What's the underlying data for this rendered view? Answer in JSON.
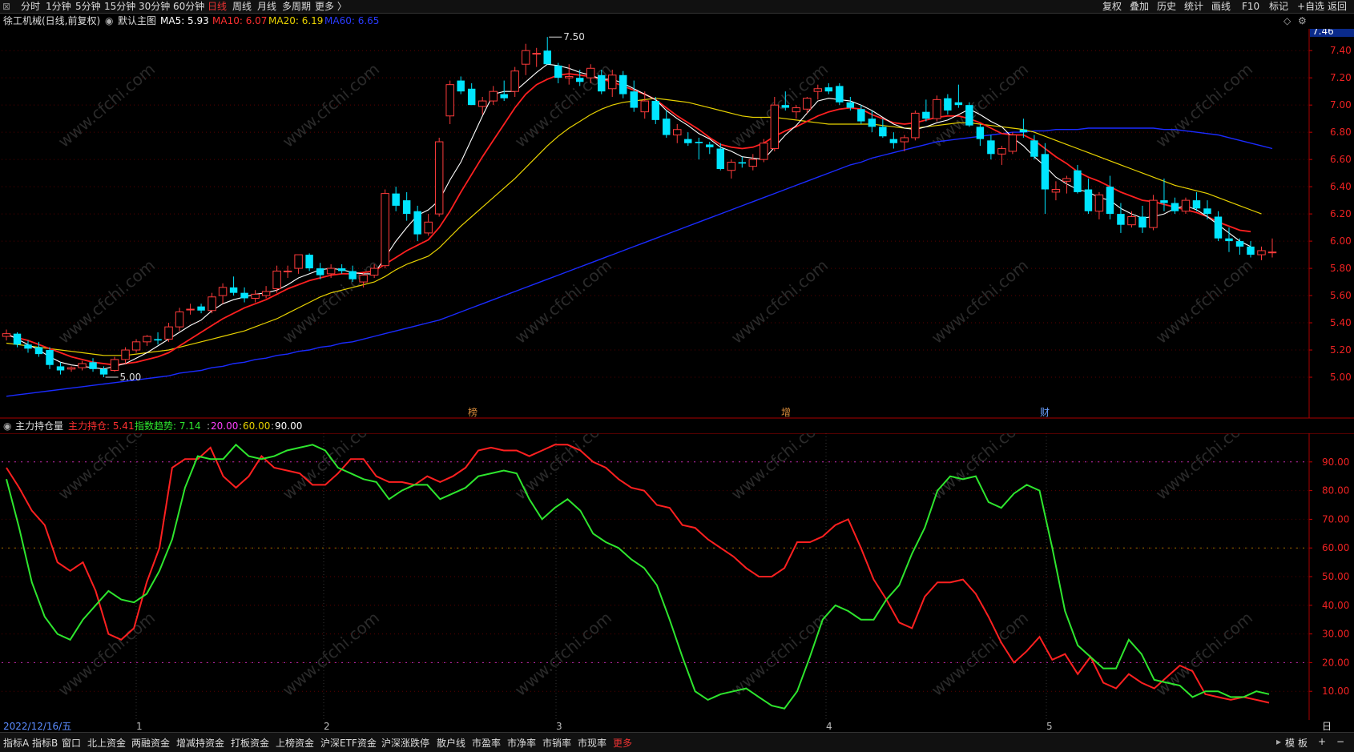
{
  "toolbar": {
    "periods": [
      "分时",
      "1分钟",
      "5分钟",
      "15分钟",
      "30分钟",
      "60分钟",
      "日线",
      "周线",
      "月线",
      "多周期",
      "更多 〉"
    ],
    "active_period": "日线",
    "right_items": [
      "复权",
      "叠加",
      "历史",
      "统计",
      "画线",
      "F10",
      "标记",
      "+自选",
      "返回"
    ]
  },
  "title": {
    "stock": "徐工机械(日线,前复权)",
    "template": "默认主图",
    "ma5": "MA5: 5.93",
    "ma10": "MA10: 6.07",
    "ma20": "MA20: 6.19",
    "ma60": "MA60: 6.65"
  },
  "colors": {
    "up": "#ff3b3b",
    "down": "#00e5ff",
    "ma5": "#ffffff",
    "ma10": "#ff2020",
    "ma20": "#e8d200",
    "ma60": "#1a2bff",
    "kdj_red": "#ff2020",
    "kdj_green": "#2ee62e",
    "grid": "#5a0000"
  },
  "indicator": {
    "name": "主力持仓量",
    "main": "主力持仓: 5.41",
    "trend": "指数趋势: 7.14",
    "l20": "20.00",
    "l60": "60.00",
    "l90": "90.00"
  },
  "price_axis": {
    "current": "7.46",
    "ticks": [
      "7.40",
      "7.20",
      "7.00",
      "6.80",
      "6.60",
      "6.40",
      "6.20",
      "6.00",
      "5.80",
      "5.60",
      "5.40",
      "5.20",
      "5.00"
    ]
  },
  "ind_axis": {
    "ticks": [
      "90.00",
      "80.00",
      "70.00",
      "60.00",
      "50.00",
      "40.00",
      "30.00",
      "20.00",
      "10.00"
    ]
  },
  "annotations": {
    "high": "7.50",
    "low": "5.00",
    "events": [
      "榜",
      "增",
      "财"
    ]
  },
  "date_axis": {
    "first_date": "2022/12/16/五",
    "months": [
      "1",
      "2",
      "3",
      "4",
      "5"
    ],
    "period": "日线"
  },
  "watermark": "www.cfchi.com",
  "bottom_tabs": [
    "指标A",
    "指标B",
    "窗口",
    "北上资金",
    "两融资金",
    "增减持资金",
    "打板资金",
    "上榜资金",
    "沪深ETF资金",
    "沪深涨跌停",
    "散户线",
    "市盈率",
    "市净率",
    "市销率",
    "市现率",
    "更多"
  ],
  "bottom_right": [
    "模",
    "板",
    "+",
    "−"
  ],
  "chart_data": {
    "type": "candlestick",
    "candles": [
      [
        5.3,
        5.35,
        5.27,
        5.32
      ],
      [
        5.32,
        5.33,
        5.22,
        5.24
      ],
      [
        5.24,
        5.27,
        5.18,
        5.21
      ],
      [
        5.22,
        5.26,
        5.15,
        5.17
      ],
      [
        5.2,
        5.22,
        5.06,
        5.09
      ],
      [
        5.08,
        5.11,
        5.02,
        5.05
      ],
      [
        5.06,
        5.08,
        5.04,
        5.07
      ],
      [
        5.07,
        5.12,
        5.05,
        5.1
      ],
      [
        5.11,
        5.14,
        5.04,
        5.06
      ],
      [
        5.06,
        5.08,
        5.0,
        5.02
      ],
      [
        5.05,
        5.15,
        5.04,
        5.13
      ],
      [
        5.13,
        5.22,
        5.1,
        5.2
      ],
      [
        5.2,
        5.28,
        5.18,
        5.26
      ],
      [
        5.26,
        5.31,
        5.23,
        5.3
      ],
      [
        5.28,
        5.33,
        5.24,
        5.27
      ],
      [
        5.28,
        5.4,
        5.26,
        5.37
      ],
      [
        5.37,
        5.51,
        5.34,
        5.48
      ],
      [
        5.5,
        5.54,
        5.46,
        5.5
      ],
      [
        5.52,
        5.54,
        5.47,
        5.49
      ],
      [
        5.49,
        5.62,
        5.47,
        5.59
      ],
      [
        5.6,
        5.69,
        5.54,
        5.66
      ],
      [
        5.66,
        5.74,
        5.6,
        5.62
      ],
      [
        5.62,
        5.66,
        5.55,
        5.58
      ],
      [
        5.58,
        5.64,
        5.55,
        5.61
      ],
      [
        5.6,
        5.67,
        5.58,
        5.63
      ],
      [
        5.65,
        5.82,
        5.62,
        5.78
      ],
      [
        5.78,
        5.82,
        5.73,
        5.78
      ],
      [
        5.8,
        5.9,
        5.76,
        5.9
      ],
      [
        5.9,
        5.91,
        5.78,
        5.8
      ],
      [
        5.8,
        5.84,
        5.72,
        5.75
      ],
      [
        5.76,
        5.83,
        5.73,
        5.8
      ],
      [
        5.8,
        5.83,
        5.76,
        5.78
      ],
      [
        5.78,
        5.82,
        5.7,
        5.72
      ],
      [
        5.7,
        5.77,
        5.66,
        5.75
      ],
      [
        5.75,
        5.83,
        5.73,
        5.8
      ],
      [
        5.82,
        6.38,
        5.8,
        6.35
      ],
      [
        6.35,
        6.4,
        6.22,
        6.26
      ],
      [
        6.3,
        6.36,
        6.15,
        6.2
      ],
      [
        6.22,
        6.26,
        6.0,
        6.05
      ],
      [
        6.06,
        6.2,
        6.04,
        6.14
      ],
      [
        6.2,
        6.76,
        6.18,
        6.73
      ],
      [
        6.92,
        7.18,
        6.86,
        7.15
      ],
      [
        7.18,
        7.21,
        7.08,
        7.1
      ],
      [
        7.12,
        7.16,
        7.0,
        7.0
      ],
      [
        6.99,
        7.06,
        6.93,
        7.03
      ],
      [
        7.03,
        7.14,
        7.0,
        7.1
      ],
      [
        7.08,
        7.18,
        7.03,
        7.05
      ],
      [
        7.1,
        7.28,
        7.06,
        7.25
      ],
      [
        7.3,
        7.45,
        7.22,
        7.4
      ],
      [
        7.38,
        7.42,
        7.28,
        7.38
      ],
      [
        7.4,
        7.5,
        7.3,
        7.3
      ],
      [
        7.29,
        7.31,
        7.16,
        7.2
      ],
      [
        7.2,
        7.3,
        7.15,
        7.21
      ],
      [
        7.2,
        7.26,
        7.14,
        7.17
      ],
      [
        7.2,
        7.3,
        7.16,
        7.27
      ],
      [
        7.22,
        7.26,
        7.08,
        7.1
      ],
      [
        7.12,
        7.26,
        7.06,
        7.22
      ],
      [
        7.22,
        7.25,
        7.05,
        7.08
      ],
      [
        7.1,
        7.18,
        6.95,
        6.98
      ],
      [
        6.95,
        7.1,
        6.9,
        7.03
      ],
      [
        7.03,
        7.06,
        6.86,
        6.89
      ],
      [
        6.9,
        6.96,
        6.76,
        6.78
      ],
      [
        6.78,
        6.86,
        6.72,
        6.82
      ],
      [
        6.75,
        6.8,
        6.7,
        6.72
      ],
      [
        6.73,
        6.76,
        6.6,
        6.72
      ],
      [
        6.71,
        6.73,
        6.64,
        6.69
      ],
      [
        6.68,
        6.72,
        6.52,
        6.53
      ],
      [
        6.52,
        6.6,
        6.46,
        6.58
      ],
      [
        6.58,
        6.62,
        6.54,
        6.57
      ],
      [
        6.55,
        6.64,
        6.52,
        6.6
      ],
      [
        6.6,
        6.75,
        6.58,
        6.72
      ],
      [
        6.68,
        7.06,
        6.66,
        7.0
      ],
      [
        7.0,
        7.1,
        6.96,
        6.98
      ],
      [
        6.95,
        7.0,
        6.9,
        6.98
      ],
      [
        6.97,
        7.06,
        6.94,
        7.05
      ],
      [
        7.1,
        7.15,
        7.04,
        7.12
      ],
      [
        7.13,
        7.16,
        7.08,
        7.1
      ],
      [
        7.14,
        7.16,
        7.0,
        7.02
      ],
      [
        7.02,
        7.06,
        6.96,
        6.98
      ],
      [
        6.97,
        7.0,
        6.86,
        6.88
      ],
      [
        6.9,
        6.96,
        6.8,
        6.84
      ],
      [
        6.84,
        6.9,
        6.76,
        6.77
      ],
      [
        6.75,
        6.8,
        6.68,
        6.72
      ],
      [
        6.73,
        6.78,
        6.66,
        6.76
      ],
      [
        6.76,
        6.96,
        6.74,
        6.94
      ],
      [
        6.95,
        7.04,
        6.88,
        6.9
      ],
      [
        6.9,
        7.07,
        6.88,
        7.04
      ],
      [
        7.05,
        7.08,
        6.93,
        6.96
      ],
      [
        7.02,
        7.15,
        6.98,
        7.0
      ],
      [
        7.0,
        7.02,
        6.84,
        6.85
      ],
      [
        6.84,
        6.86,
        6.7,
        6.75
      ],
      [
        6.74,
        6.78,
        6.6,
        6.64
      ],
      [
        6.64,
        6.7,
        6.56,
        6.68
      ],
      [
        6.66,
        6.8,
        6.64,
        6.78
      ],
      [
        6.82,
        6.9,
        6.76,
        6.8
      ],
      [
        6.74,
        6.78,
        6.6,
        6.62
      ],
      [
        6.64,
        6.72,
        6.2,
        6.38
      ],
      [
        6.36,
        6.44,
        6.3,
        6.38
      ],
      [
        6.44,
        6.48,
        6.35,
        6.46
      ],
      [
        6.52,
        6.56,
        6.35,
        6.36
      ],
      [
        6.38,
        6.46,
        6.2,
        6.22
      ],
      [
        6.22,
        6.36,
        6.16,
        6.34
      ],
      [
        6.4,
        6.48,
        6.16,
        6.2
      ],
      [
        6.2,
        6.28,
        6.06,
        6.12
      ],
      [
        6.12,
        6.22,
        6.1,
        6.18
      ],
      [
        6.18,
        6.26,
        6.06,
        6.1
      ],
      [
        6.1,
        6.34,
        6.08,
        6.3
      ],
      [
        6.3,
        6.46,
        6.22,
        6.28
      ],
      [
        6.28,
        6.32,
        6.2,
        6.22
      ],
      [
        6.22,
        6.32,
        6.2,
        6.3
      ],
      [
        6.3,
        6.36,
        6.22,
        6.24
      ],
      [
        6.24,
        6.3,
        6.16,
        6.2
      ],
      [
        6.18,
        6.22,
        6.0,
        6.02
      ],
      [
        6.02,
        6.1,
        5.92,
        6.0
      ],
      [
        6.0,
        6.02,
        5.9,
        5.96
      ],
      [
        5.96,
        6.0,
        5.88,
        5.9
      ],
      [
        5.9,
        5.96,
        5.86,
        5.93
      ],
      [
        5.92,
        6.02,
        5.88,
        5.92
      ]
    ],
    "ma60": [
      4.86,
      4.87,
      4.88,
      4.89,
      4.9,
      4.91,
      4.92,
      4.93,
      4.94,
      4.95,
      4.96,
      4.97,
      4.98,
      4.99,
      5.0,
      5.01,
      5.03,
      5.04,
      5.05,
      5.07,
      5.08,
      5.1,
      5.11,
      5.13,
      5.14,
      5.16,
      5.17,
      5.19,
      5.2,
      5.22,
      5.23,
      5.25,
      5.26,
      5.28,
      5.3,
      5.32,
      5.34,
      5.36,
      5.38,
      5.4,
      5.42,
      5.45,
      5.48,
      5.51,
      5.54,
      5.57,
      5.6,
      5.63,
      5.66,
      5.69,
      5.72,
      5.75,
      5.78,
      5.81,
      5.84,
      5.87,
      5.9,
      5.93,
      5.96,
      5.99,
      6.02,
      6.05,
      6.08,
      6.11,
      6.14,
      6.17,
      6.2,
      6.23,
      6.26,
      6.29,
      6.32,
      6.35,
      6.38,
      6.41,
      6.44,
      6.47,
      6.5,
      6.53,
      6.56,
      6.58,
      6.61,
      6.63,
      6.65,
      6.67,
      6.69,
      6.71,
      6.73,
      6.74,
      6.75,
      6.76,
      6.77,
      6.78,
      6.79,
      6.8,
      6.8,
      6.81,
      6.81,
      6.82,
      6.82,
      6.82,
      6.83,
      6.83,
      6.83,
      6.83,
      6.83,
      6.83,
      6.83,
      6.82,
      6.82,
      6.81,
      6.8,
      6.79,
      6.78,
      6.76,
      6.74,
      6.72,
      6.7,
      6.68
    ],
    "ma20": [
      5.25,
      5.24,
      5.23,
      5.22,
      5.21,
      5.2,
      5.19,
      5.18,
      5.17,
      5.16,
      5.16,
      5.16,
      5.17,
      5.18,
      5.19,
      5.2,
      5.22,
      5.24,
      5.26,
      5.28,
      5.3,
      5.32,
      5.34,
      5.37,
      5.4,
      5.43,
      5.47,
      5.51,
      5.55,
      5.59,
      5.62,
      5.64,
      5.66,
      5.68,
      5.7,
      5.74,
      5.79,
      5.83,
      5.86,
      5.89,
      5.95,
      6.03,
      6.11,
      6.18,
      6.25,
      6.32,
      6.39,
      6.46,
      6.54,
      6.62,
      6.7,
      6.77,
      6.83,
      6.88,
      6.93,
      6.97,
      7.0,
      7.02,
      7.03,
      7.04,
      7.05,
      7.04,
      7.03,
      7.02,
      7.0,
      6.98,
      6.96,
      6.94,
      6.92,
      6.91,
      6.91,
      6.91,
      6.9,
      6.89,
      6.88,
      6.87,
      6.86,
      6.86,
      6.86,
      6.86,
      6.86,
      6.85,
      6.84,
      6.83,
      6.83,
      6.84,
      6.85,
      6.86,
      6.87,
      6.87,
      6.86,
      6.85,
      6.84,
      6.83,
      6.82,
      6.8,
      6.77,
      6.74,
      6.71,
      6.68,
      6.65,
      6.62,
      6.59,
      6.56,
      6.53,
      6.5,
      6.47,
      6.44,
      6.41,
      6.39,
      6.37,
      6.35,
      6.32,
      6.29,
      6.26,
      6.23,
      6.2
    ],
    "ma10": [
      5.31,
      5.29,
      5.27,
      5.24,
      5.21,
      5.18,
      5.15,
      5.13,
      5.11,
      5.1,
      5.09,
      5.1,
      5.11,
      5.13,
      5.15,
      5.18,
      5.23,
      5.28,
      5.33,
      5.38,
      5.43,
      5.47,
      5.51,
      5.54,
      5.57,
      5.61,
      5.65,
      5.68,
      5.71,
      5.73,
      5.75,
      5.76,
      5.76,
      5.77,
      5.78,
      5.83,
      5.88,
      5.93,
      5.97,
      6.01,
      6.1,
      6.22,
      6.36,
      6.49,
      6.62,
      6.74,
      6.86,
      6.98,
      7.08,
      7.15,
      7.19,
      7.22,
      7.23,
      7.22,
      7.21,
      7.19,
      7.17,
      7.14,
      7.11,
      7.08,
      7.04,
      6.98,
      6.92,
      6.87,
      6.82,
      6.76,
      6.71,
      6.69,
      6.68,
      6.69,
      6.72,
      6.77,
      6.81,
      6.84,
      6.88,
      6.92,
      6.95,
      6.97,
      6.98,
      6.97,
      6.93,
      6.9,
      6.87,
      6.86,
      6.87,
      6.89,
      6.91,
      6.92,
      6.92,
      6.9,
      6.87,
      6.83,
      6.79,
      6.78,
      6.78,
      6.74,
      6.68,
      6.62,
      6.57,
      6.51,
      6.47,
      6.44,
      6.4,
      6.36,
      6.33,
      6.3,
      6.29,
      6.27,
      6.25,
      6.23,
      6.21,
      6.18,
      6.14,
      6.11,
      6.08,
      6.07
    ],
    "ma5": [
      5.32,
      5.28,
      5.24,
      5.2,
      5.15,
      5.11,
      5.09,
      5.08,
      5.07,
      5.06,
      5.08,
      5.1,
      5.14,
      5.18,
      5.23,
      5.28,
      5.33,
      5.38,
      5.42,
      5.49,
      5.54,
      5.57,
      5.59,
      5.61,
      5.62,
      5.64,
      5.68,
      5.73,
      5.76,
      5.79,
      5.8,
      5.79,
      5.77,
      5.76,
      5.76,
      5.88,
      6.0,
      6.1,
      6.19,
      6.23,
      6.3,
      6.45,
      6.58,
      6.75,
      6.92,
      7.08,
      7.1,
      7.1,
      7.17,
      7.24,
      7.3,
      7.29,
      7.27,
      7.24,
      7.22,
      7.19,
      7.19,
      7.16,
      7.12,
      7.08,
      7.04,
      6.96,
      6.9,
      6.85,
      6.79,
      6.75,
      6.69,
      6.66,
      6.62,
      6.61,
      6.6,
      6.69,
      6.78,
      6.85,
      6.94,
      7.03,
      7.05,
      7.04,
      7.03,
      7.0,
      6.96,
      6.91,
      6.86,
      6.83,
      6.82,
      6.84,
      6.87,
      6.89,
      6.93,
      6.97,
      6.93,
      6.88,
      6.84,
      6.76,
      6.7,
      6.62,
      6.55,
      6.47,
      6.42,
      6.38,
      6.36,
      6.32,
      6.3,
      6.24,
      6.2,
      6.17,
      6.18,
      6.2,
      6.24,
      6.26,
      6.23,
      6.18,
      6.12,
      6.06,
      6.0,
      5.96
    ],
    "ind_red": [
      88,
      81,
      73,
      68,
      55,
      52,
      55,
      45,
      30,
      28,
      32,
      48,
      60,
      88,
      91,
      91,
      95,
      85,
      81,
      85,
      92,
      88,
      87,
      86,
      82,
      82,
      86,
      91,
      91,
      85,
      83,
      83,
      82,
      85,
      83,
      85,
      88,
      94,
      95,
      94,
      94,
      92,
      94,
      96,
      96,
      94,
      90,
      88,
      84,
      81,
      80,
      75,
      74,
      68,
      67,
      63,
      60,
      57,
      53,
      50,
      50,
      53,
      62,
      62,
      64,
      68,
      70,
      60,
      49,
      42,
      34,
      32,
      43,
      48,
      48,
      49,
      44,
      36,
      27,
      20,
      24,
      29,
      21,
      23,
      16,
      22,
      13,
      11,
      16,
      13,
      11,
      15,
      19,
      17,
      9,
      8,
      7,
      8,
      7,
      6
    ],
    "ind_green": [
      84,
      67,
      48,
      36,
      30,
      28,
      35,
      40,
      45,
      42,
      41,
      44,
      52,
      63,
      81,
      92,
      91,
      91,
      96,
      92,
      91,
      92,
      94,
      95,
      96,
      94,
      88,
      86,
      84,
      83,
      77,
      80,
      82,
      82,
      77,
      79,
      81,
      85,
      86,
      87,
      86,
      77,
      70,
      74,
      77,
      73,
      65,
      62,
      60,
      56,
      53,
      47,
      35,
      22,
      10,
      7,
      9,
      10,
      11,
      8,
      5,
      4,
      10,
      22,
      35,
      40,
      38,
      35,
      35,
      42,
      47,
      58,
      67,
      80,
      85,
      84,
      85,
      76,
      74,
      79,
      82,
      80,
      60,
      38,
      26,
      22,
      18,
      18,
      28,
      23,
      14,
      13,
      12,
      8,
      10,
      10,
      8,
      8,
      10,
      9
    ]
  }
}
